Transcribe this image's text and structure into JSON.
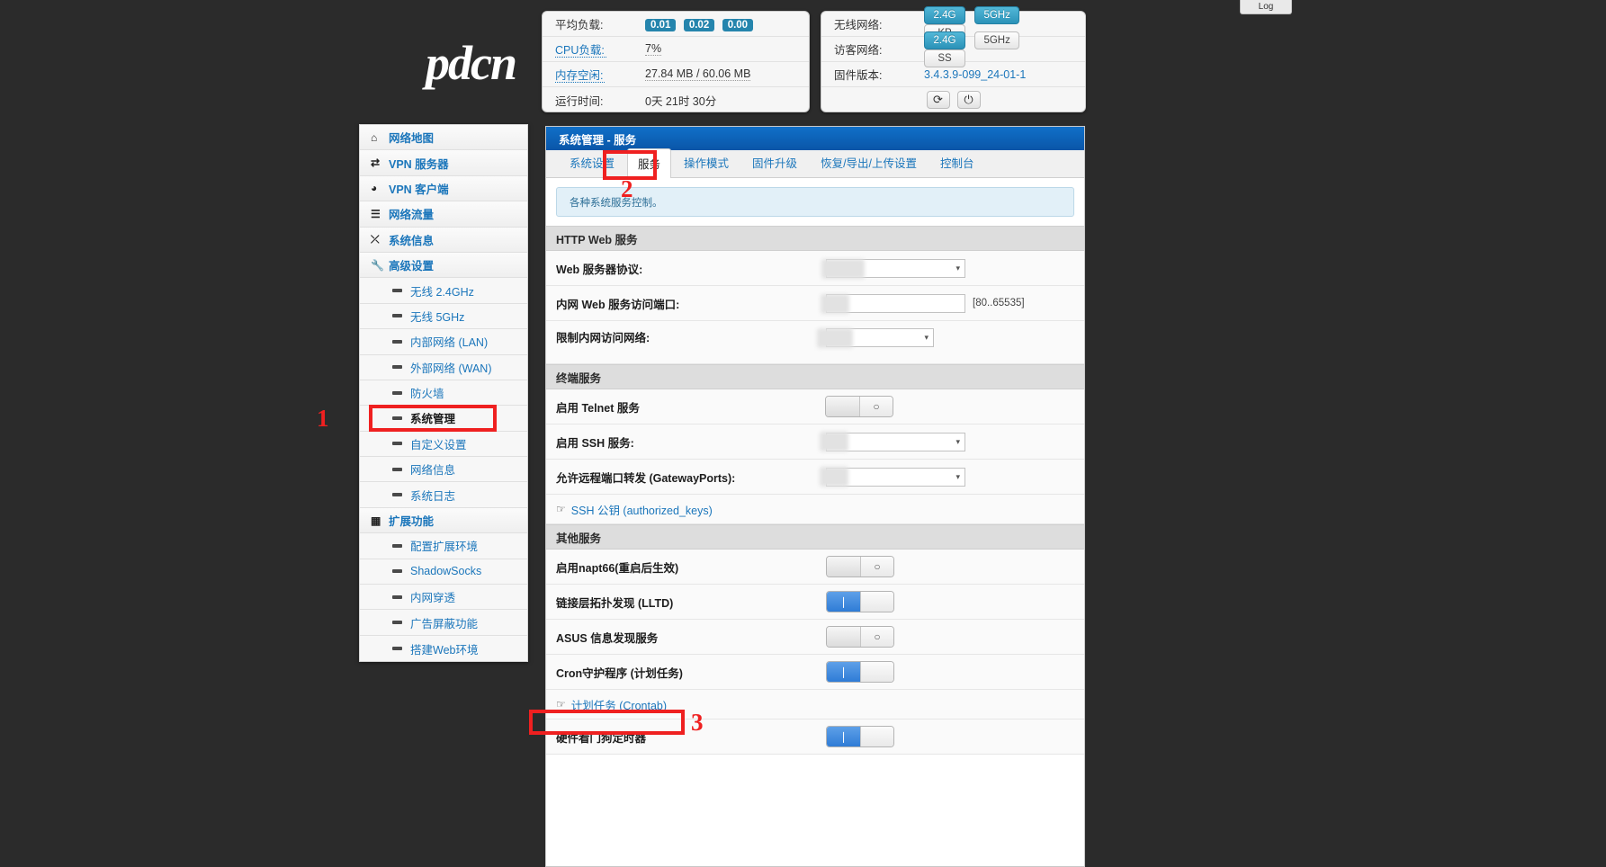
{
  "log_tab": {
    "label": "Log"
  },
  "brand": {
    "logo_text": "pdcn"
  },
  "status_left": {
    "rows": [
      {
        "label": "平均负载:",
        "type": "badges",
        "values": [
          "0.01",
          "0.02",
          "0.00"
        ]
      },
      {
        "label": "CPU负载:",
        "type": "link_label",
        "value": "7%"
      },
      {
        "label": "内存空闲:",
        "type": "link_label",
        "value": "27.84 MB / 60.06 MB"
      },
      {
        "label": "运行时间:",
        "type": "plain",
        "value": "0天 21时 30分"
      }
    ]
  },
  "status_right": {
    "rows": [
      {
        "label": "无线网络:",
        "pills": [
          {
            "text": "2.4G",
            "active": true
          },
          {
            "text": "5GHz",
            "active": true
          },
          {
            "text": "KP",
            "active": false
          }
        ]
      },
      {
        "label": "访客网络:",
        "pills": [
          {
            "text": "2.4G",
            "active": true
          },
          {
            "text": "5GHz",
            "active": false
          },
          {
            "text": "SS",
            "active": false
          }
        ]
      },
      {
        "label": "固件版本:",
        "value": "3.4.3.9-099_24-01-1"
      }
    ],
    "buttons": [
      {
        "name": "reboot-button",
        "glyph": "⟳"
      },
      {
        "name": "power-button",
        "glyph": "⏻"
      }
    ]
  },
  "sidebar": {
    "items": [
      {
        "label": "网络地图",
        "icon": "home-icon",
        "level": "top",
        "glyph": "⌂"
      },
      {
        "label": "VPN 服务器",
        "icon": "vpn-server-icon",
        "level": "top",
        "glyph": "⇄"
      },
      {
        "label": "VPN 客户端",
        "icon": "globe-icon",
        "level": "top",
        "glyph": "◕"
      },
      {
        "label": "网络流量",
        "icon": "traffic-icon",
        "level": "top",
        "glyph": "☰"
      },
      {
        "label": "系统信息",
        "icon": "shuffle-icon",
        "level": "top",
        "glyph": "⤫"
      },
      {
        "label": "高级设置",
        "icon": "wrench-icon",
        "level": "top",
        "glyph": "🔧"
      },
      {
        "label": "无线 2.4GHz",
        "level": "sub"
      },
      {
        "label": "无线 5GHz",
        "level": "sub"
      },
      {
        "label": "内部网络 (LAN)",
        "level": "sub"
      },
      {
        "label": "外部网络 (WAN)",
        "level": "sub"
      },
      {
        "label": "防火墙",
        "level": "sub"
      },
      {
        "label": "系统管理",
        "level": "sub",
        "active": true
      },
      {
        "label": "自定义设置",
        "level": "sub"
      },
      {
        "label": "网络信息",
        "level": "sub"
      },
      {
        "label": "系统日志",
        "level": "sub"
      },
      {
        "label": "扩展功能",
        "icon": "grid-icon",
        "level": "top",
        "glyph": "▦"
      },
      {
        "label": "配置扩展环境",
        "level": "sub"
      },
      {
        "label": "ShadowSocks",
        "level": "sub"
      },
      {
        "label": "内网穿透",
        "level": "sub"
      },
      {
        "label": "广告屏蔽功能",
        "level": "sub"
      },
      {
        "label": "搭建Web环境",
        "level": "sub"
      }
    ]
  },
  "main": {
    "title": "系统管理 - 服务",
    "tabs": [
      {
        "label": "系统设置",
        "active": false
      },
      {
        "label": "服务",
        "active": true
      },
      {
        "label": "操作模式",
        "active": false
      },
      {
        "label": "固件升级",
        "active": false
      },
      {
        "label": "恢复/导出/上传设置",
        "active": false
      },
      {
        "label": "控制台",
        "active": false
      }
    ],
    "notice": "各种系统服务控制。",
    "sections": [
      {
        "heading": "HTTP Web 服务",
        "rows": [
          {
            "label": "Web 服务器协议:",
            "control": "select",
            "blurred": true
          },
          {
            "label": "内网 Web 服务访问端口:",
            "control": "text",
            "blurred": true,
            "hint": "[80..65535]"
          },
          {
            "label": "限制内网访问网络:",
            "control": "select-small",
            "blurred": true
          }
        ]
      },
      {
        "heading": "终端服务",
        "rows": [
          {
            "label": "启用 Telnet 服务",
            "control": "toggle",
            "state": "off"
          },
          {
            "label": "启用 SSH 服务:",
            "control": "select-small",
            "blurred": true
          },
          {
            "label": "允许远程端口转发 (GatewayPorts):",
            "control": "select-small",
            "blurred": true
          }
        ],
        "link": {
          "label": "SSH 公钥 (authorized_keys)"
        }
      },
      {
        "heading": "其他服务",
        "rows": [
          {
            "label": "启用napt66(重启后生效)",
            "control": "toggle",
            "state": "off"
          },
          {
            "label": "链接层拓扑发现 (LLTD)",
            "control": "toggle",
            "state": "on"
          },
          {
            "label": "ASUS 信息发现服务",
            "control": "toggle",
            "state": "off"
          },
          {
            "label": "Cron守护程序 (计划任务)",
            "control": "toggle",
            "state": "on"
          }
        ],
        "link": {
          "label": "计划任务 (Crontab)"
        },
        "rows_after": [
          {
            "label": "硬件看门狗定时器",
            "control": "toggle",
            "state": "on"
          }
        ]
      }
    ]
  },
  "annotations": [
    {
      "number": "1",
      "target": "sidebar-item-系统管理"
    },
    {
      "number": "2",
      "target": "tab-服务"
    },
    {
      "number": "3",
      "target": "crontab-link"
    }
  ],
  "colors": {
    "accent_blue": "#1b76bb",
    "title_bar": "#0a56a8",
    "badge_blue": "#2585ad",
    "toggle_on": "#2f7cd6",
    "annotation_red": "#ef2020",
    "page_bg": "#2b2b2b"
  }
}
